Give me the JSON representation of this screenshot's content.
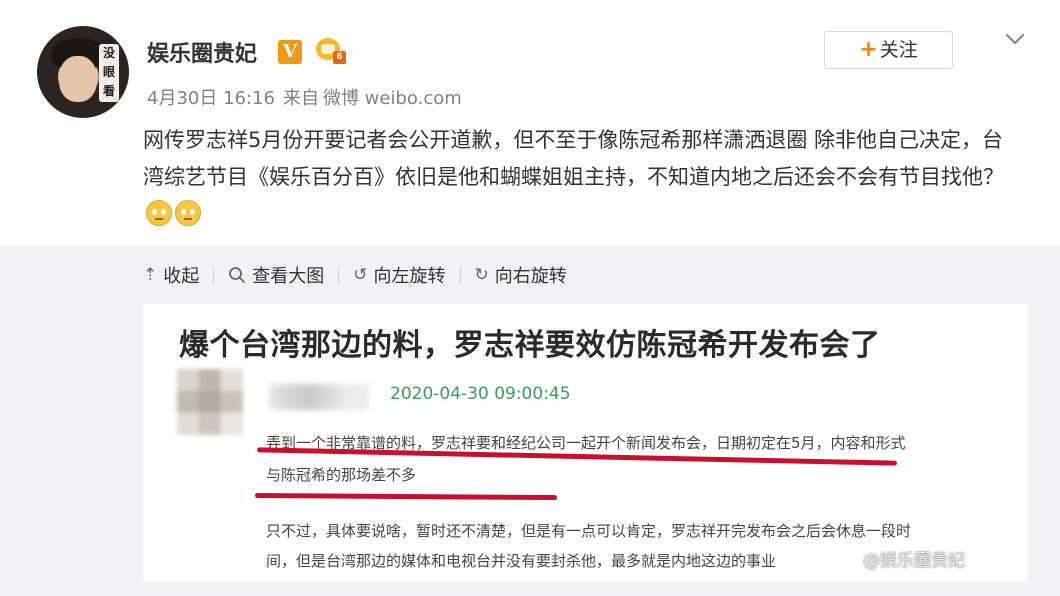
{
  "author": {
    "name": "娱乐圈贵妃",
    "verified_badge": "V",
    "vip_level": "6",
    "avatar_text": "没眼看",
    "avatar_icon": "avatar"
  },
  "meta": {
    "date": "4月30日 16:16",
    "source_prefix": "来自",
    "source": "微博 weibo.com"
  },
  "follow_button": {
    "icon": "+",
    "label": "关注"
  },
  "post": {
    "text": "网传罗志祥5月份开要记者会公开道歉，但不至于像陈冠希那样潇洒退圈 除非他自己决定，台湾综艺节目《娱乐百分百》依旧是他和蝴蝶姐姐主持，不知道内地之后还会不会有节目找他？",
    "emojis": [
      "emoji-doubt",
      "emoji-doubt"
    ]
  },
  "media_toolbar": {
    "collapse": {
      "icon": "collapse-icon",
      "label": "收起"
    },
    "view_large": {
      "icon": "magnifier-icon",
      "label": "查看大图"
    },
    "rotate_left": {
      "icon": "rotate-left-icon",
      "label": "向左旋转"
    },
    "rotate_right": {
      "icon": "rotate-right-icon",
      "label": "向右旋转"
    }
  },
  "image": {
    "title": "爆个台湾那边的料，罗志祥要效仿陈冠希开发布会了",
    "date": "2020-04-30 09:00:45",
    "para1_line1": "弄到一个非常靠谱的料，罗志祥要和经纪公司一起开个新闻发布会，日期初定在5月，内容和形式",
    "para1_line2": "与陈冠希的那场差不多",
    "para2_line1": "只不过，具体要说啥，暂时还不清楚，但是有一点可以肯定，罗志祥开完发布会之后会休息一段时",
    "para2_line2": "间，但是台湾那边的媒体和电视台并没有要封杀他，最多就是内地这边的事业",
    "watermark": "@娱乐圈贵妃",
    "highlight_color": "#c8102e"
  },
  "colors": {
    "accent": "#ff8200",
    "verified": "#f09a13",
    "date_green": "#3d9a5a"
  }
}
